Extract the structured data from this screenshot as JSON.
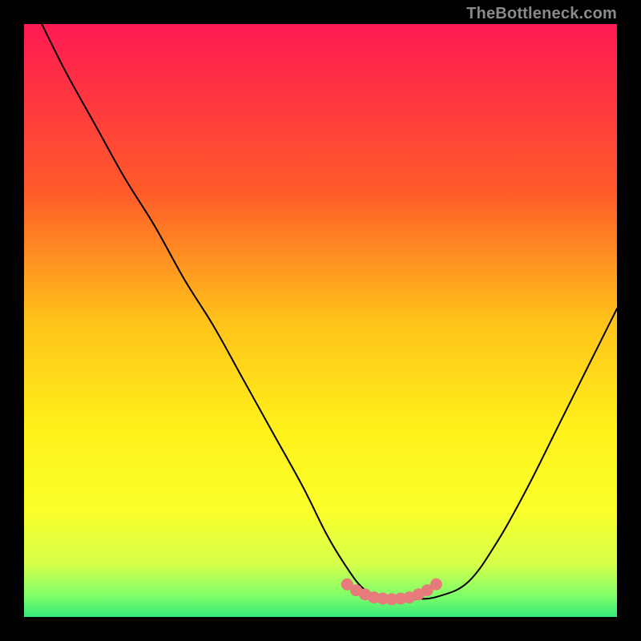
{
  "watermark": "TheBottleneck.com",
  "colors": {
    "bg": "#000000",
    "gradient_stops": [
      {
        "offset": 0.0,
        "color": "#ff1a52"
      },
      {
        "offset": 0.28,
        "color": "#ff5a2a"
      },
      {
        "offset": 0.5,
        "color": "#ffc21a"
      },
      {
        "offset": 0.68,
        "color": "#fff01a"
      },
      {
        "offset": 0.82,
        "color": "#faff2a"
      },
      {
        "offset": 0.91,
        "color": "#d6ff4a"
      },
      {
        "offset": 0.965,
        "color": "#7dff6a"
      },
      {
        "offset": 1.0,
        "color": "#36e87a"
      }
    ],
    "curve": "#000000",
    "marker": "#e77b7b"
  },
  "chart_data": {
    "type": "line",
    "title": "",
    "xlabel": "",
    "ylabel": "",
    "xlim": [
      0,
      100
    ],
    "ylim": [
      0,
      100
    ],
    "grid": false,
    "legend": false,
    "series": [
      {
        "name": "bottleneck-curve",
        "x": [
          3,
          7,
          12,
          17,
          22,
          27,
          32,
          37,
          42,
          47,
          51,
          54,
          57,
          60,
          63,
          66,
          70,
          75,
          80,
          85,
          90,
          95,
          100
        ],
        "y": [
          100,
          92,
          83,
          74,
          66,
          57,
          49,
          40,
          31,
          22,
          14,
          9,
          5,
          3.5,
          3,
          3,
          3.5,
          6,
          13,
          22,
          32,
          42,
          52
        ]
      }
    ],
    "markers": {
      "name": "highlight-dots",
      "x": [
        54.5,
        56,
        57.5,
        59,
        60.5,
        62,
        63.5,
        65,
        66.5,
        68,
        69.5
      ],
      "y": [
        5.5,
        4.5,
        3.8,
        3.3,
        3.1,
        3.0,
        3.1,
        3.3,
        3.8,
        4.5,
        5.5
      ]
    }
  }
}
